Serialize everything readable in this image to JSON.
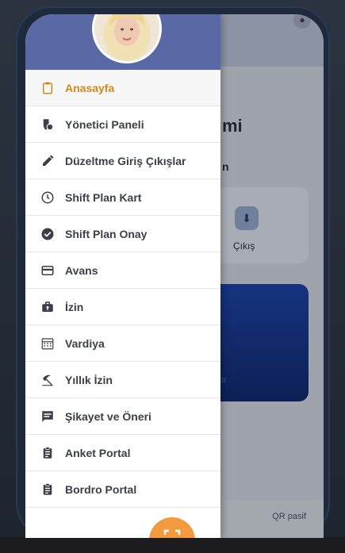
{
  "menu": {
    "items": [
      {
        "label": "Anasayfa",
        "icon": "clipboard-icon",
        "active": true
      },
      {
        "label": "Yönetici Paneli",
        "icon": "manager-icon"
      },
      {
        "label": "Düzeltme Giriş Çıkışlar",
        "icon": "pencil-icon"
      },
      {
        "label": "Shift Plan Kart",
        "icon": "clock-icon"
      },
      {
        "label": "Shift Plan Onay",
        "icon": "check-circle-icon"
      },
      {
        "label": "Avans",
        "icon": "credit-card-icon"
      },
      {
        "label": "İzin",
        "icon": "briefcase-icon"
      },
      {
        "label": "Vardiya",
        "icon": "calendar-icon"
      },
      {
        "label": "Yıllık İzin",
        "icon": "beach-umbrella-icon"
      },
      {
        "label": "Şikayet ve Öneri",
        "icon": "message-icon"
      },
      {
        "label": "Anket Portal",
        "icon": "clipboard-list-icon"
      },
      {
        "label": "Bordro Portal",
        "icon": "clipboard-list-icon"
      }
    ]
  },
  "background": {
    "title_fragment": "mi",
    "subtitle_fragment": "n",
    "exit_label": "Çıkış",
    "card_text_fragment": "ur",
    "qr_status": "QR pasif"
  },
  "colors": {
    "accent": "#d4881b",
    "drawer_header": "#5869a6",
    "fab": "#f39a3e"
  }
}
